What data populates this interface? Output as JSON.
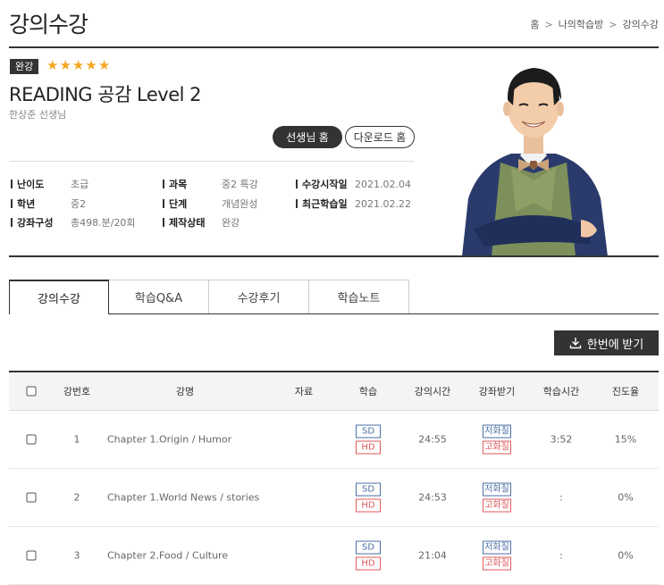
{
  "page": {
    "title": "강의수강"
  },
  "breadcrumb": [
    "홈",
    "나의학습방",
    "강의수강"
  ],
  "course": {
    "badge": "완강",
    "rating": 5,
    "stars": "★★★★★",
    "title": "READING 공감 Level 2",
    "teacher": "한상준 선생님",
    "teacher_home_label": "선생님 홈",
    "download_home_label": "다운로드 홈"
  },
  "info": {
    "difficulty": {
      "label": "난이도",
      "value": "초급"
    },
    "subject": {
      "label": "과목",
      "value": "중2 특강"
    },
    "start_date": {
      "label": "수강시작일",
      "value": "2021.02.04"
    },
    "grade": {
      "label": "학년",
      "value": "중2"
    },
    "stage": {
      "label": "단계",
      "value": "개념완성"
    },
    "last_study": {
      "label": "최근학습일",
      "value": "2021.02.22"
    },
    "composition": {
      "label": "강좌구성",
      "value": "총498.분/20회"
    },
    "status": {
      "label": "제작상태",
      "value": "완강"
    }
  },
  "tabs": [
    {
      "label": "강의수강",
      "active": true
    },
    {
      "label": "학습Q&A",
      "active": false
    },
    {
      "label": "수강후기",
      "active": false
    },
    {
      "label": "학습노트",
      "active": false
    }
  ],
  "bulk_download_label": "한번에 받기",
  "table": {
    "headers": {
      "num": "강번호",
      "name": "강명",
      "material": "자료",
      "study": "학습",
      "duration": "강의시간",
      "download": "강좌받기",
      "study_time": "학습시간",
      "progress": "진도율"
    },
    "quality": {
      "sd": "SD",
      "hd": "HD",
      "low": "저화질",
      "high": "고화질"
    },
    "rows": [
      {
        "num": "1",
        "name": "Chapter 1.Origin / Humor",
        "duration": "24:55",
        "study_time": "3:52",
        "progress": "15%"
      },
      {
        "num": "2",
        "name": "Chapter 1.World News / stories",
        "duration": "24:53",
        "study_time": ":",
        "progress": "0%"
      },
      {
        "num": "3",
        "name": "Chapter 2.Food / Culture",
        "duration": "21:04",
        "study_time": ":",
        "progress": "0%"
      }
    ]
  },
  "colors": {
    "dark": "#333333",
    "star": "#f5a623",
    "sd_blue": "#4a6fa5",
    "hd_red": "#e05a5a"
  }
}
